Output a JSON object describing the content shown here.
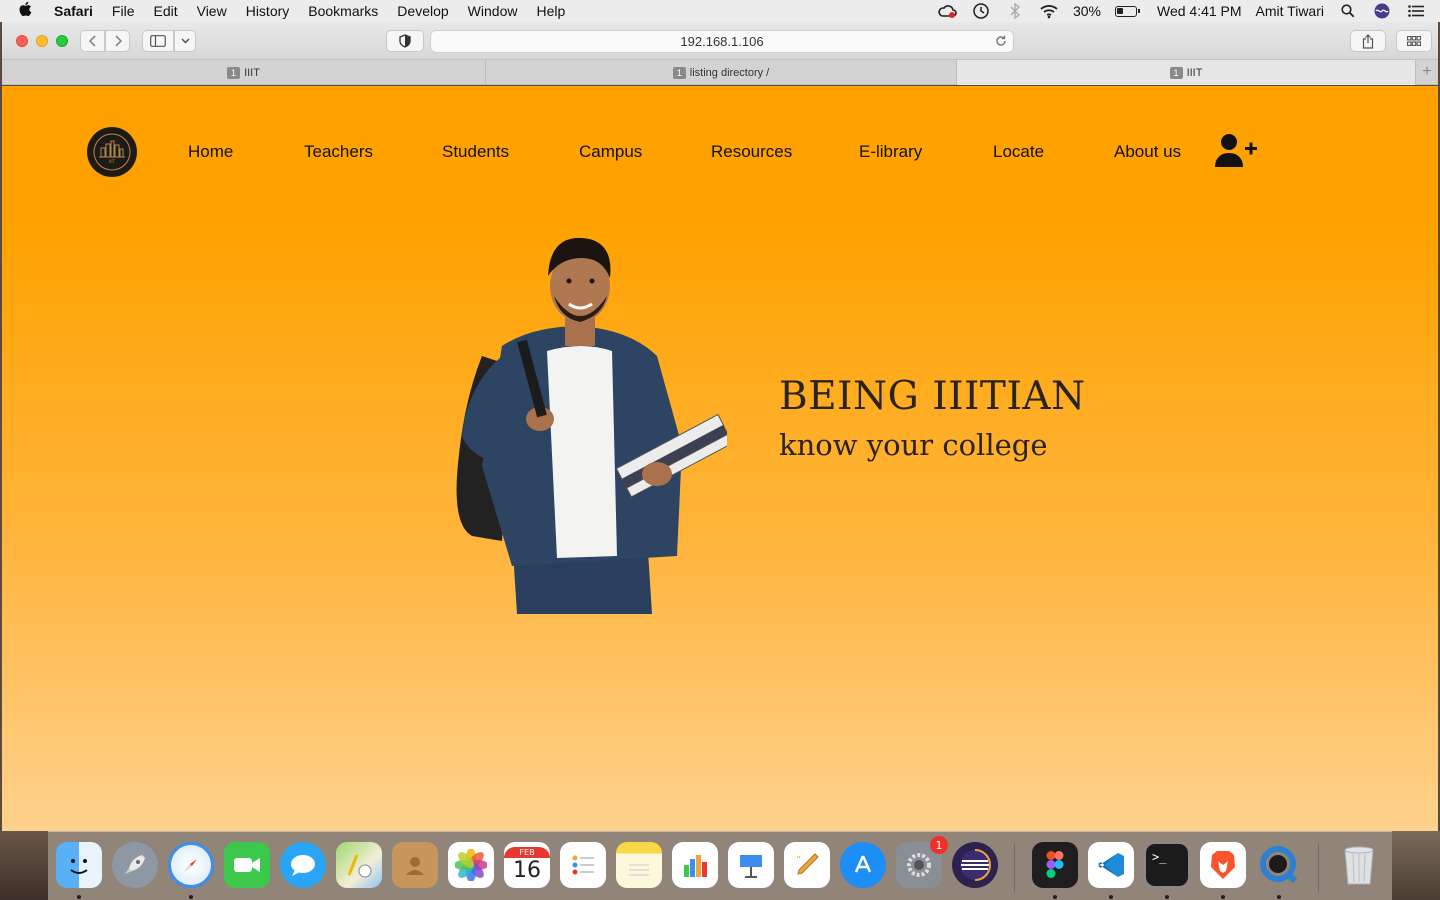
{
  "menubar": {
    "app_name": "Safari",
    "items": [
      "File",
      "Edit",
      "View",
      "History",
      "Bookmarks",
      "Develop",
      "Window",
      "Help"
    ],
    "battery": "30%",
    "clock": "Wed 4:41 PM",
    "user": "Amit Tiwari"
  },
  "browser": {
    "url": "192.168.1.106",
    "tabs": [
      {
        "num": "1",
        "label": "IIIT",
        "active": false
      },
      {
        "num": "1",
        "label": "listing directory /",
        "active": false
      },
      {
        "num": "1",
        "label": "IIIT",
        "active": true
      }
    ]
  },
  "site": {
    "logo_text": "IIIT",
    "nav": [
      "Home",
      "Teachers",
      "Students",
      "Campus",
      "Resources",
      "E-library",
      "Locate",
      "About us"
    ],
    "hero_title": "BEING IIITIAN",
    "hero_subtitle": "know your college"
  },
  "colors": {
    "page_top": "#ffa200",
    "page_bottom": "#ffd28e",
    "text_dark": "#2a2320"
  },
  "dock": {
    "apps": [
      {
        "name": "Finder",
        "icon": "finder-icon",
        "running": true
      },
      {
        "name": "Launchpad",
        "icon": "rocket-icon",
        "running": false
      },
      {
        "name": "Safari",
        "icon": "compass-icon",
        "running": true
      },
      {
        "name": "FaceTime",
        "icon": "video-camera-icon",
        "running": false
      },
      {
        "name": "Messages",
        "icon": "speech-bubble-icon",
        "running": false
      },
      {
        "name": "Maps",
        "icon": "map-icon",
        "running": false
      },
      {
        "name": "Contacts",
        "icon": "address-book-icon",
        "running": false
      },
      {
        "name": "Photos",
        "icon": "flower-icon",
        "running": false
      },
      {
        "name": "Calendar",
        "icon": "calendar-icon",
        "running": false,
        "month": "FEB",
        "day": "16"
      },
      {
        "name": "Reminders",
        "icon": "checklist-icon",
        "running": false
      },
      {
        "name": "Notes",
        "icon": "notepad-icon",
        "running": false
      },
      {
        "name": "Numbers",
        "icon": "bar-chart-icon",
        "running": false
      },
      {
        "name": "Keynote",
        "icon": "podium-icon",
        "running": false
      },
      {
        "name": "Pages",
        "icon": "pen-icon",
        "running": false
      },
      {
        "name": "App Store",
        "icon": "app-store-icon",
        "running": false
      },
      {
        "name": "System Preferences",
        "icon": "gear-icon",
        "running": false,
        "badge": "1"
      },
      {
        "name": "Eclipse",
        "icon": "eclipse-icon",
        "running": false
      },
      {
        "name": "Figma",
        "icon": "figma-icon",
        "running": true
      },
      {
        "name": "VS Code",
        "icon": "vscode-icon",
        "running": true
      },
      {
        "name": "Terminal",
        "icon": "terminal-icon",
        "running": true
      },
      {
        "name": "Brave",
        "icon": "lion-icon",
        "running": true
      },
      {
        "name": "QuickTime",
        "icon": "quicktime-icon",
        "running": true
      },
      {
        "name": "Trash",
        "icon": "trash-icon",
        "running": false
      }
    ]
  }
}
